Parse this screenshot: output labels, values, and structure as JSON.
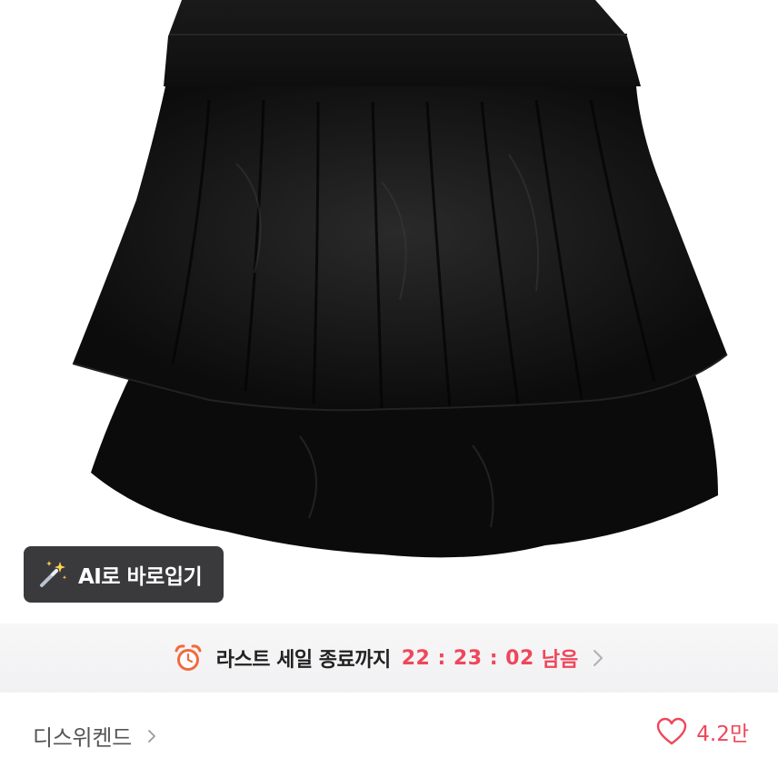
{
  "image": {
    "subject": "black tiered mini skirt"
  },
  "ai_button": {
    "label": "AI로 바로입기",
    "icon": "magic-wand-icon"
  },
  "sale": {
    "text": "라스트 세일 종료까지",
    "timer": "22 : 23 : 02",
    "remaining": "남음",
    "accent": "#f0465a",
    "icon": "alarm-clock-icon"
  },
  "brand": {
    "name": "디스위켄드",
    "icon": "chevron-right-icon"
  },
  "like": {
    "count": "4.2만",
    "icon": "heart-icon"
  }
}
